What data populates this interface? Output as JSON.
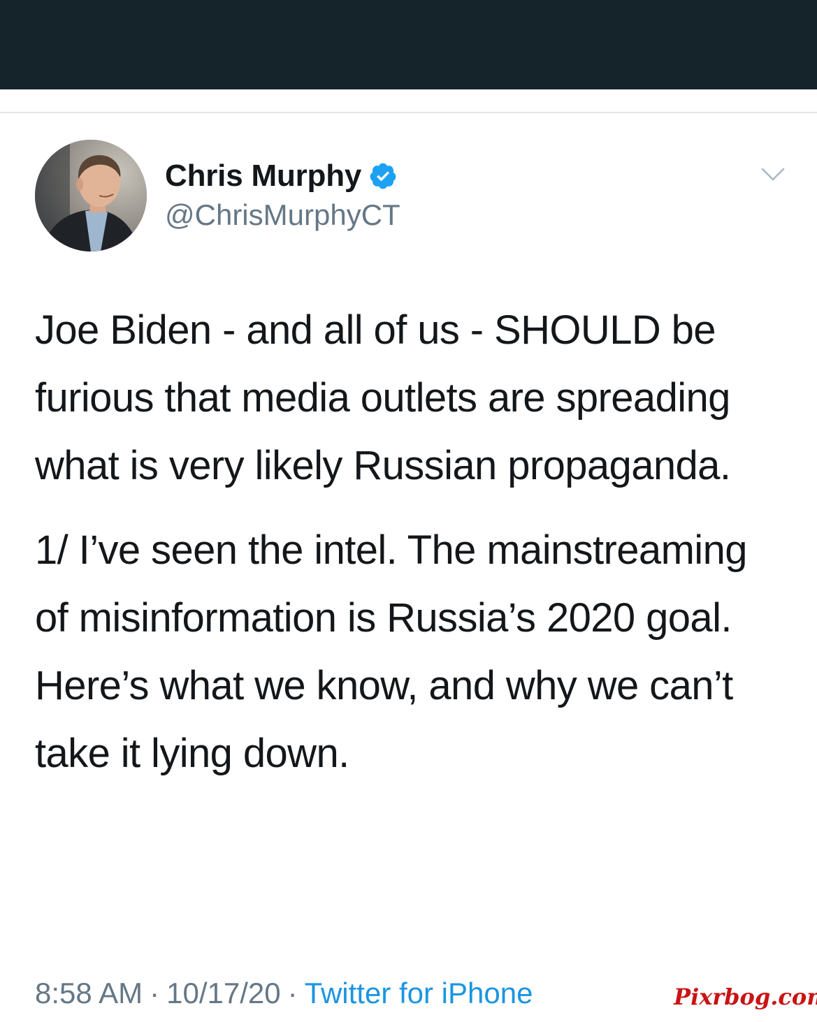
{
  "author": {
    "name": "Chris Murphy",
    "handle": "@ChrisMurphyCT",
    "verified_icon": "verified-badge-icon",
    "avatar_icon": "avatar-photo"
  },
  "tweet": {
    "paragraphs": [
      "Joe Biden - and all of us - SHOULD be furious that media outlets are spreading what is very likely Russian propaganda.",
      "1/ I’ve seen the intel. The mainstreaming of misinformation is Russia’s 2020 goal. Here’s what we know, and why we can’t take it lying down."
    ]
  },
  "meta": {
    "time": "8:58 AM",
    "separator": "·",
    "date": "10/17/20",
    "source": "Twitter for iPhone"
  },
  "watermark": "Pixrbog.com",
  "colors": {
    "top_bar": "#15232a",
    "link": "#1b95e0",
    "verified": "#1da1f2",
    "secondary_text": "#657786",
    "watermark": "#c81414"
  }
}
